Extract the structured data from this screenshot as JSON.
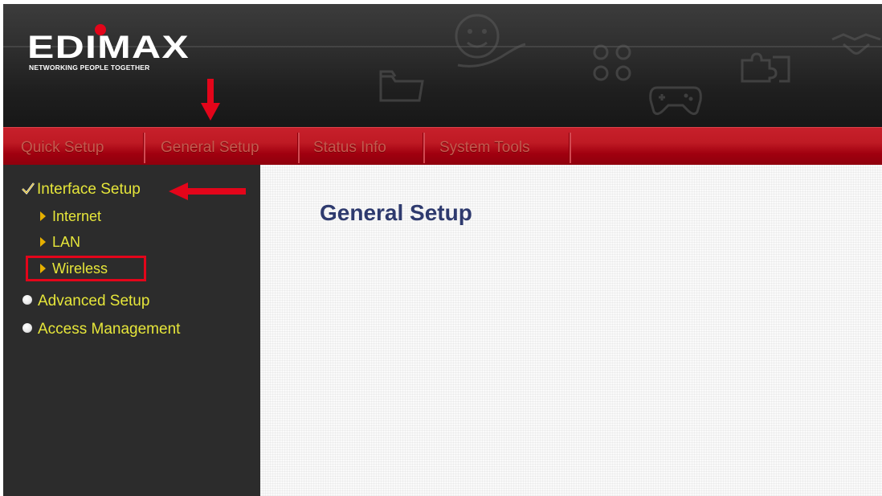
{
  "brand": {
    "name": "EDIMAX",
    "tagline": "NETWORKING PEOPLE TOGETHER",
    "colors": {
      "red": "#e3051a",
      "nav_red": "#b50f1b",
      "menu_text": "#e6e63a",
      "title": "#2e3a6e"
    }
  },
  "header_icons": [
    "folder-icon",
    "smiley-hand-icon",
    "circles-icon",
    "gamepad-icon",
    "puzzle-icon",
    "handshake-icon"
  ],
  "nav": {
    "tabs": [
      {
        "label": "Quick Setup"
      },
      {
        "label": "General Setup"
      },
      {
        "label": "Status Info"
      },
      {
        "label": "System Tools"
      }
    ]
  },
  "sidebar": {
    "interface_setup": "Interface Setup",
    "sub_items": [
      {
        "label": "Internet"
      },
      {
        "label": "LAN"
      },
      {
        "label": "Wireless"
      }
    ],
    "advanced_setup": "Advanced Setup",
    "access_management": "Access Management"
  },
  "content": {
    "title": "General Setup"
  }
}
